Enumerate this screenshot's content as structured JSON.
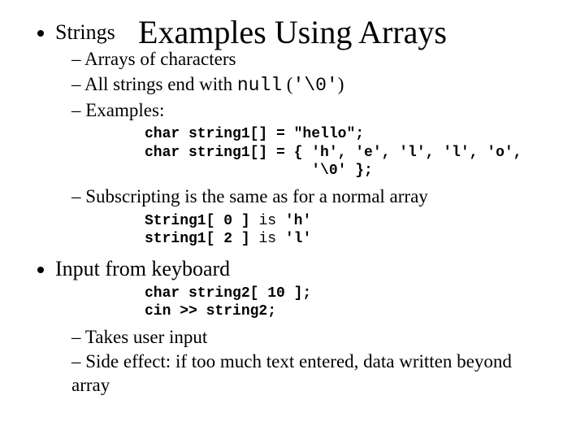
{
  "title": "Examples Using Arrays",
  "b1": {
    "label": "Strings",
    "s1": "Arrays of characters",
    "s2_a": "All strings end with ",
    "s2_b": "null",
    "s2_c": " (",
    "s2_d": "'\\0'",
    "s2_e": ")",
    "s3": "Examples:",
    "code1": "char string1[] = \"hello\";\nchar string1[] = { 'h', 'e', 'l', 'l', 'o',\n                   '\\0' };",
    "s4": "Subscripting is the same as for a normal array",
    "code2_l1a": "String1[ 0 ] ",
    "code2_l1b": "is ",
    "code2_l1c": "'h'",
    "code2_l2a": "string1[ 2 ] ",
    "code2_l2b": "is ",
    "code2_l2c": "'l'"
  },
  "b2": {
    "label": "Input from keyboard",
    "code3": "char string2[ 10 ];\ncin >> string2;",
    "s1": "Takes user input",
    "s2": "Side effect: if too much text entered, data written beyond array"
  }
}
